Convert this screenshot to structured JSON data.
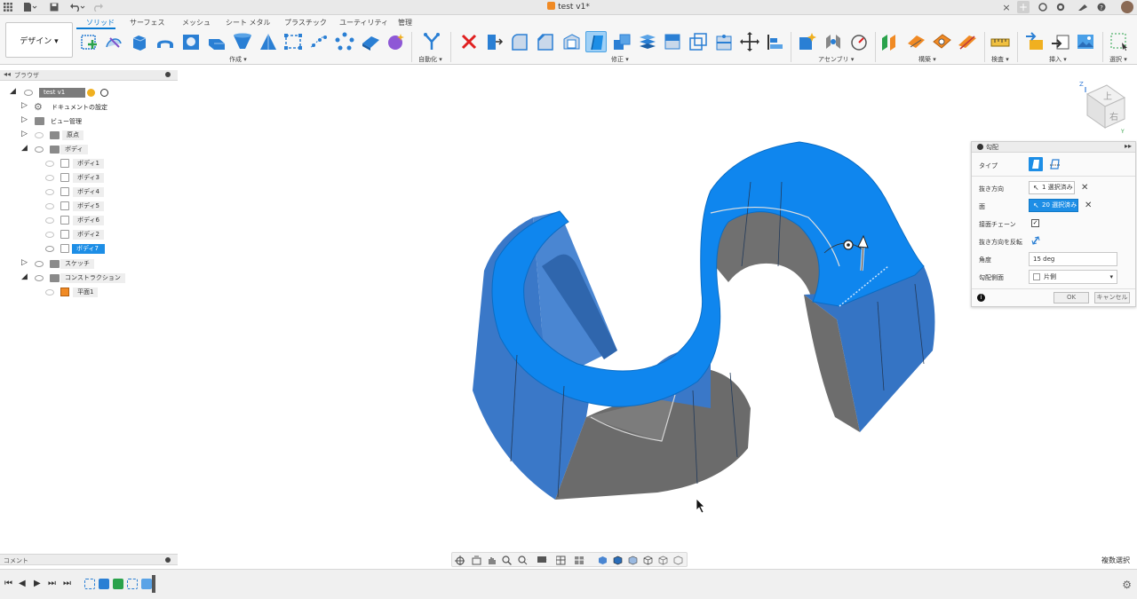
{
  "titlebar": {
    "doc_title": "test v1*",
    "close_symbol": "×",
    "add_tab_symbol": "+"
  },
  "ribbon": {
    "workspace_label": "デザイン ▾",
    "tabs": [
      "ソリッド",
      "サーフェス",
      "メッシュ",
      "シート メタル",
      "プラスチック",
      "ユーティリティ",
      "管理"
    ],
    "active_tab": "ソリッド",
    "groups": {
      "create": "作成 ▾",
      "automate": "自動化 ▾",
      "modify": "修正 ▾",
      "assemble": "アセンブリ ▾",
      "construct": "構築 ▾",
      "inspect": "検査 ▾",
      "insert": "挿入 ▾",
      "select": "選択 ▾"
    }
  },
  "browser": {
    "title": "ブラウザ",
    "root": "test v1",
    "items": {
      "doc_settings": "ドキュメントの設定",
      "named_views": "ビュー管理",
      "origin": "原点",
      "bodies": "ボディ",
      "sketches": "スケッチ",
      "construction": "コンストラクション",
      "plane": "平面1"
    },
    "bodies": [
      "ボディ1",
      "ボディ3",
      "ボディ4",
      "ボディ5",
      "ボディ6",
      "ボディ2",
      "ボディ7"
    ],
    "selected_body": "ボディ7"
  },
  "draft_panel": {
    "title": "勾配",
    "type_label": "タイプ",
    "pull_direction_label": "抜き方向",
    "pull_direction_value": "1 選択済み",
    "faces_label": "面",
    "faces_value": "20 選択済み",
    "tangent_chain_label": "接面チェーン",
    "tangent_chain_checked": "✓",
    "flip_label": "抜き方向を反転",
    "angle_label": "角度",
    "angle_value": "15 deg",
    "draft_side_label": "勾配側面",
    "draft_side_value": "片側",
    "ok_label": "OK",
    "cancel_label": "キャンセル",
    "info_symbol": "i",
    "clear_symbol": "✕"
  },
  "viewcube": {
    "top_face": "上",
    "right_face": "右",
    "axis_z": "Z",
    "axis_y": "Y"
  },
  "comment_bar": {
    "title": "コメント"
  },
  "status": {
    "multi_select": "複数選択"
  },
  "colors": {
    "accent": "#1d8ee6",
    "selected_face": "#0f86ee",
    "side_face": "#3a78c8",
    "gray_face": "#6d6d6d"
  }
}
